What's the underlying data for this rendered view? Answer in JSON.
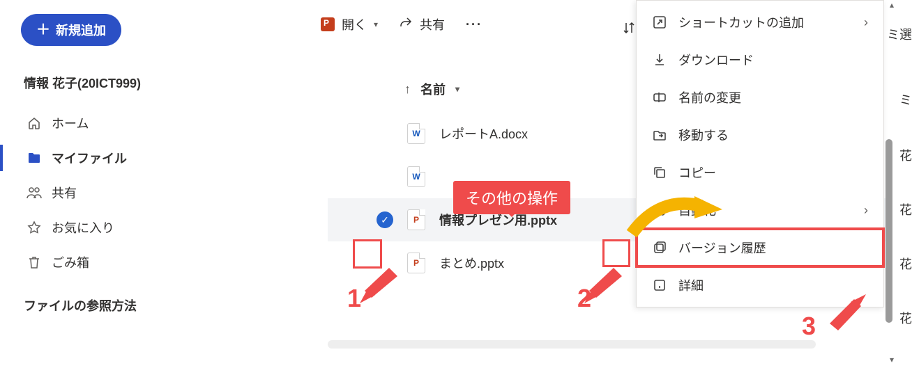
{
  "sidebar": {
    "new_button": "新規追加",
    "user": "情報 花子(20ICT999)",
    "items": [
      {
        "label": "ホーム"
      },
      {
        "label": "マイファイル"
      },
      {
        "label": "共有"
      },
      {
        "label": "お気に入り"
      },
      {
        "label": "ごみ箱"
      }
    ],
    "section_title": "ファイルの参照方法"
  },
  "toolbar": {
    "open": "開く",
    "share": "共有"
  },
  "columns": {
    "name": "名前"
  },
  "files": [
    {
      "name": "レポートA.docx",
      "type": "word"
    },
    {
      "name": "",
      "type": "word"
    },
    {
      "name": "情報プレゼン用.pptx",
      "type": "ppt",
      "selected": true
    },
    {
      "name": "まとめ.pptx",
      "type": "ppt"
    }
  ],
  "context_menu": [
    {
      "label": "ショートカットの追加",
      "has_submenu": true
    },
    {
      "label": "ダウンロード"
    },
    {
      "label": "名前の変更"
    },
    {
      "label": "移動する"
    },
    {
      "label": "コピー"
    },
    {
      "label": "自動化",
      "has_submenu": true
    },
    {
      "label": "バージョン履歴",
      "highlight": true
    },
    {
      "label": "詳細"
    }
  ],
  "annotations": {
    "callout": "その他の操作",
    "num1": "1",
    "num2": "2",
    "num3": "3"
  },
  "right_edge_fragments": [
    "ミ選",
    "ミ",
    "花",
    "花",
    "花",
    "花"
  ]
}
